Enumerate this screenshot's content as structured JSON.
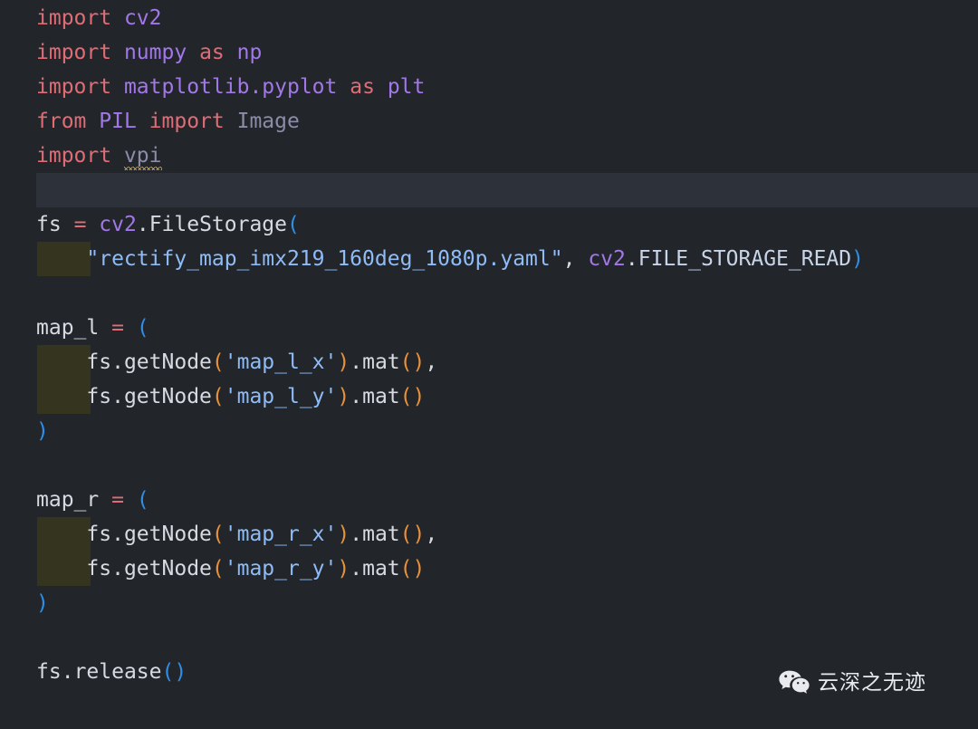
{
  "editor": {
    "theme": "one-dark",
    "background_color": "#22262b",
    "active_line_color": "#2c313a",
    "indent_guide_color": "#34341f",
    "language": "python",
    "colors": {
      "keyword": "#e06c75",
      "module": "#a277e8",
      "string": "#8fbcf7",
      "constant": "#c8d4e8",
      "plain": "#d7dae0",
      "bracket_level_1": "#2e8fe8",
      "bracket_level_2": "#e8913a",
      "warning_squiggle": "#e5c07b"
    },
    "lines": [
      {
        "index": 1,
        "text": "import cv2",
        "tokens": [
          {
            "t": "import",
            "c": "kw"
          },
          {
            "t": " ",
            "c": "plain"
          },
          {
            "t": "cv2",
            "c": "mod"
          }
        ]
      },
      {
        "index": 2,
        "text": "import numpy as np",
        "tokens": [
          {
            "t": "import",
            "c": "kw"
          },
          {
            "t": " ",
            "c": "plain"
          },
          {
            "t": "numpy",
            "c": "mod"
          },
          {
            "t": " ",
            "c": "plain"
          },
          {
            "t": "as",
            "c": "kw"
          },
          {
            "t": " ",
            "c": "plain"
          },
          {
            "t": "np",
            "c": "mod"
          }
        ]
      },
      {
        "index": 3,
        "text": "import matplotlib.pyplot as plt",
        "tokens": [
          {
            "t": "import",
            "c": "kw"
          },
          {
            "t": " ",
            "c": "plain"
          },
          {
            "t": "matplotlib",
            "c": "mod"
          },
          {
            "t": ".",
            "c": "mod"
          },
          {
            "t": "pyplot",
            "c": "mod"
          },
          {
            "t": " ",
            "c": "plain"
          },
          {
            "t": "as",
            "c": "kw"
          },
          {
            "t": " ",
            "c": "plain"
          },
          {
            "t": "plt",
            "c": "mod"
          }
        ]
      },
      {
        "index": 4,
        "text": "from PIL import Image",
        "tokens": [
          {
            "t": "from",
            "c": "kw"
          },
          {
            "t": " ",
            "c": "plain"
          },
          {
            "t": "PIL",
            "c": "mod"
          },
          {
            "t": " ",
            "c": "plain"
          },
          {
            "t": "import",
            "c": "kw"
          },
          {
            "t": " ",
            "c": "plain"
          },
          {
            "t": "Image",
            "c": "cls"
          }
        ]
      },
      {
        "index": 5,
        "text": "import vpi",
        "warning": true,
        "warning_token": "vpi",
        "tokens": [
          {
            "t": "import",
            "c": "kw"
          },
          {
            "t": " ",
            "c": "plain"
          },
          {
            "t": "vpi",
            "c": "cls"
          }
        ]
      },
      {
        "index": 6,
        "text": "",
        "active": true,
        "tokens": []
      },
      {
        "index": 7,
        "text": "fs = cv2.FileStorage(",
        "tokens": [
          {
            "t": "fs",
            "c": "plain"
          },
          {
            "t": " ",
            "c": "plain"
          },
          {
            "t": "=",
            "c": "op"
          },
          {
            "t": " ",
            "c": "plain"
          },
          {
            "t": "cv2",
            "c": "mod"
          },
          {
            "t": ".",
            "c": "dot"
          },
          {
            "t": "FileStorage",
            "c": "plain"
          },
          {
            "t": "(",
            "c": "br1"
          }
        ]
      },
      {
        "index": 8,
        "text": "    \"rectify_map_imx219_160deg_1080p.yaml\", cv2.FILE_STORAGE_READ)",
        "indent_block": true,
        "tokens": [
          {
            "t": "    ",
            "c": "plain"
          },
          {
            "t": "\"rectify_map_imx219_160deg_1080p.yaml\"",
            "c": "str"
          },
          {
            "t": ",",
            "c": "punc"
          },
          {
            "t": " ",
            "c": "plain"
          },
          {
            "t": "cv2",
            "c": "mod"
          },
          {
            "t": ".",
            "c": "dot"
          },
          {
            "t": "FILE_STORAGE_READ",
            "c": "const"
          },
          {
            "t": ")",
            "c": "br1"
          }
        ]
      },
      {
        "index": 9,
        "text": "",
        "tokens": []
      },
      {
        "index": 10,
        "text": "map_l = (",
        "tokens": [
          {
            "t": "map_l",
            "c": "plain"
          },
          {
            "t": " ",
            "c": "plain"
          },
          {
            "t": "=",
            "c": "op"
          },
          {
            "t": " ",
            "c": "plain"
          },
          {
            "t": "(",
            "c": "br1"
          }
        ]
      },
      {
        "index": 11,
        "text": "    fs.getNode('map_l_x').mat(),",
        "indent_block": true,
        "tokens": [
          {
            "t": "    ",
            "c": "plain"
          },
          {
            "t": "fs",
            "c": "plain"
          },
          {
            "t": ".",
            "c": "dot"
          },
          {
            "t": "getNode",
            "c": "plain"
          },
          {
            "t": "(",
            "c": "br2"
          },
          {
            "t": "'map_l_x'",
            "c": "str"
          },
          {
            "t": ")",
            "c": "br2"
          },
          {
            "t": ".",
            "c": "dot"
          },
          {
            "t": "mat",
            "c": "plain"
          },
          {
            "t": "(",
            "c": "br2"
          },
          {
            "t": ")",
            "c": "br2"
          },
          {
            "t": ",",
            "c": "punc"
          }
        ]
      },
      {
        "index": 12,
        "text": "    fs.getNode('map_l_y').mat()",
        "indent_block": true,
        "tokens": [
          {
            "t": "    ",
            "c": "plain"
          },
          {
            "t": "fs",
            "c": "plain"
          },
          {
            "t": ".",
            "c": "dot"
          },
          {
            "t": "getNode",
            "c": "plain"
          },
          {
            "t": "(",
            "c": "br2"
          },
          {
            "t": "'map_l_y'",
            "c": "str"
          },
          {
            "t": ")",
            "c": "br2"
          },
          {
            "t": ".",
            "c": "dot"
          },
          {
            "t": "mat",
            "c": "plain"
          },
          {
            "t": "(",
            "c": "br2"
          },
          {
            "t": ")",
            "c": "br2"
          }
        ]
      },
      {
        "index": 13,
        "text": ")",
        "tokens": [
          {
            "t": ")",
            "c": "br1"
          }
        ]
      },
      {
        "index": 14,
        "text": "",
        "tokens": []
      },
      {
        "index": 15,
        "text": "map_r = (",
        "tokens": [
          {
            "t": "map_r",
            "c": "plain"
          },
          {
            "t": " ",
            "c": "plain"
          },
          {
            "t": "=",
            "c": "op"
          },
          {
            "t": " ",
            "c": "plain"
          },
          {
            "t": "(",
            "c": "br1"
          }
        ]
      },
      {
        "index": 16,
        "text": "    fs.getNode('map_r_x').mat(),",
        "indent_block": true,
        "tokens": [
          {
            "t": "    ",
            "c": "plain"
          },
          {
            "t": "fs",
            "c": "plain"
          },
          {
            "t": ".",
            "c": "dot"
          },
          {
            "t": "getNode",
            "c": "plain"
          },
          {
            "t": "(",
            "c": "br2"
          },
          {
            "t": "'map_r_x'",
            "c": "str"
          },
          {
            "t": ")",
            "c": "br2"
          },
          {
            "t": ".",
            "c": "dot"
          },
          {
            "t": "mat",
            "c": "plain"
          },
          {
            "t": "(",
            "c": "br2"
          },
          {
            "t": ")",
            "c": "br2"
          },
          {
            "t": ",",
            "c": "punc"
          }
        ]
      },
      {
        "index": 17,
        "text": "    fs.getNode('map_r_y').mat()",
        "indent_block": true,
        "tokens": [
          {
            "t": "    ",
            "c": "plain"
          },
          {
            "t": "fs",
            "c": "plain"
          },
          {
            "t": ".",
            "c": "dot"
          },
          {
            "t": "getNode",
            "c": "plain"
          },
          {
            "t": "(",
            "c": "br2"
          },
          {
            "t": "'map_r_y'",
            "c": "str"
          },
          {
            "t": ")",
            "c": "br2"
          },
          {
            "t": ".",
            "c": "dot"
          },
          {
            "t": "mat",
            "c": "plain"
          },
          {
            "t": "(",
            "c": "br2"
          },
          {
            "t": ")",
            "c": "br2"
          }
        ]
      },
      {
        "index": 18,
        "text": ")",
        "tokens": [
          {
            "t": ")",
            "c": "br1"
          }
        ]
      },
      {
        "index": 19,
        "text": "",
        "tokens": []
      },
      {
        "index": 20,
        "text": "fs.release()",
        "tokens": [
          {
            "t": "fs",
            "c": "plain"
          },
          {
            "t": ".",
            "c": "dot"
          },
          {
            "t": "release",
            "c": "plain"
          },
          {
            "t": "(",
            "c": "br1"
          },
          {
            "t": ")",
            "c": "br1"
          }
        ]
      }
    ]
  },
  "watermark": {
    "icon": "wechat-icon",
    "label": "云深之无迹",
    "color": "#e8eaed"
  }
}
